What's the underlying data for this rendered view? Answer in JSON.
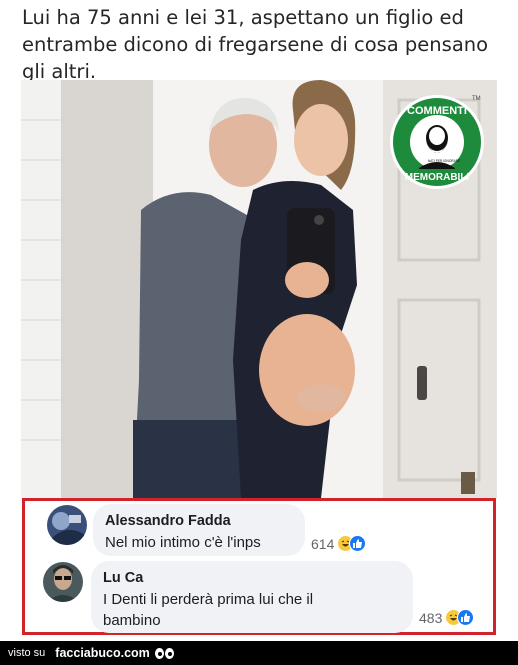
{
  "post": {
    "caption": "Lui ha 75 anni e lei 31, aspettano un figlio ed entrambe dicono di fregarsene di cosa pensano gli altri."
  },
  "photo": {
    "subject": "older man embracing pregnant woman taking mirror selfie",
    "logo": {
      "top_text": "COMMENTI",
      "bottom_text": "MEMORABILI",
      "center_text": "NATI PER IGNORARE",
      "trademark": "TM",
      "color": "#1e8a3c"
    }
  },
  "comments": [
    {
      "author": "Alessandro Fadda",
      "text": "Nel mio intimo c'è l'inps",
      "reactions_count": "614",
      "reaction_icons": [
        "laugh-emoji",
        "like-icon"
      ]
    },
    {
      "author": "Lu Ca",
      "text": "I Denti li perderà prima lui che il bambino",
      "reactions_count": "483",
      "reaction_icons": [
        "laugh-emoji",
        "like-icon"
      ]
    }
  ],
  "footer": {
    "seen_label": "visto su",
    "site": "facciabuco.com"
  },
  "colors": {
    "highlight_border": "#d2222a",
    "bubble_bg": "#f0f2f5",
    "like_blue": "#1877f2",
    "laugh_yellow": "#f7c93b"
  }
}
